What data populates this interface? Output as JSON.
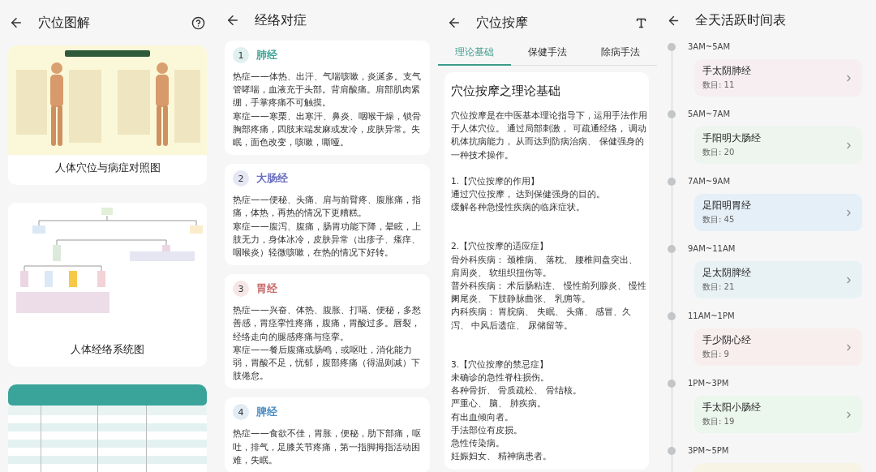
{
  "acupoint_charts": {
    "title": "穴位图解",
    "items": [
      {
        "kind": "picture",
        "caption": "人体穴位与病症对照图"
      },
      {
        "kind": "picture",
        "caption": "人体经络系统图"
      },
      {
        "kind": "picture"
      }
    ]
  },
  "meridian_symptoms": {
    "title": "经络对症",
    "items": [
      {
        "number": "1",
        "name": "肺经",
        "color": "#3fa595",
        "paragraphs": [
          "热症——体热、出汗、气喘咳嗽，炎涎多。支气管哮喘，血液充于头部。背肩酸痛。肩部肌肉紧绷，手掌疼痛不可触摸。",
          "寒症——寒栗、出寒汗、鼻炎、咽喉干燥，锁骨胸部疼痛，四肢末端发麻或发冷，皮肤异常。失眠，面色改变，咳嗽，嘶哑。"
        ]
      },
      {
        "number": "2",
        "name": "大肠经",
        "color": "#6a6fbf",
        "paragraphs": [
          "热症——便秘、头痛、肩与前臂疼、腹胀痛，指痛，体热，再热的情况下更糟糕。",
          "寒症——腹泻、腹痛，肠胃功能下降，晕眩，上肢无力，身体冰冷，皮肤异常（出疹子、瘙痒、咽喉炎）轻微咳嗽，在热的情况下好转。"
        ]
      },
      {
        "number": "3",
        "name": "胃经",
        "color": "#c96a6a",
        "paragraphs": [
          "热症——兴奋、体热、腹胀、打嗝、便秘，多愁善感，胃痉挛性疼痛，腹痛，胃酸过多。唇裂，经络走向的腿感疼痛与痉挛。",
          "寒症——餐后腹痛或肠鸣，或呕吐，消化能力弱，胃酸不足，忧郁，腹部疼痛（得温则减）下肢倦怠。"
        ]
      },
      {
        "number": "4",
        "name": "脾经",
        "color": "#4a8cc4",
        "paragraphs": [
          "热症——食欲不佳，胃胀，便秘，肋下部痛，呕吐，排气，足膝关节疼痛，第一指脚拇指活动困难，失眠。"
        ]
      }
    ]
  },
  "acupressure": {
    "title": "穴位按摩",
    "tabs": [
      {
        "label": "理论基础",
        "selected": true
      },
      {
        "label": "保健手法",
        "selected": false
      },
      {
        "label": "除病手法",
        "selected": false
      }
    ],
    "article": {
      "heading": "穴位按摩之理论基础",
      "intro": [
        "穴位按摩是在中医基本理论指导下，运用手法作用",
        "于人体穴位。 通过局部刺激， 可疏通经络， 调动",
        "机体抗病能力， 从而达到防病治病、 保健强身的",
        "一种技术操作。"
      ],
      "sections": [
        {
          "heading": "1.【穴位按摩的作用】",
          "lines": [
            "通过穴位按摩， 达到保健强身的目的。",
            "缓解各种急慢性疾病的临床症状。"
          ]
        },
        {
          "heading": "2.【穴位按摩的适应症】",
          "lines": [
            "骨外科疾病： 颈椎病、 落枕、 腰椎间盘突出、",
            "肩周炎、 软组织扭伤等。",
            "普外科疾病： 术后肠粘连、 慢性前列腺炎、 慢性",
            "阑尾炎、 下肢静脉曲张、 乳痈等。",
            "内科疾病： 胃脘病、 失眠、 头痛、 感冒、久",
            "泻、 中风后遗症、 尿储留等。"
          ]
        },
        {
          "heading": "3.【穴位按摩的禁忌症】",
          "lines": [
            "未确诊的急性脊柱损伤。",
            "各种骨折、 骨质疏松、 骨结核。",
            "严重心、 脑、 肺疾病。",
            "有出血倾向者。",
            "手法部位有皮损。",
            "急性传染病。",
            "妊娠妇女、 精神病患者。"
          ]
        }
      ]
    }
  },
  "daily_schedule": {
    "title": "全天活跃时间表",
    "items": [
      {
        "time": "3AM~5AM",
        "name": "手太阴肺经",
        "count": "数目: 11",
        "color": "#f6eef1"
      },
      {
        "time": "5AM~7AM",
        "name": "手阳明大肠经",
        "count": "数目: 20",
        "color": "#edf5ee"
      },
      {
        "time": "7AM~9AM",
        "name": "足阳明胃经",
        "count": "数目: 45",
        "color": "#e5eff7"
      },
      {
        "time": "9AM~11AM",
        "name": "足太阴脾经",
        "count": "数目: 21",
        "color": "#e8f2f5"
      },
      {
        "time": "11AM~1PM",
        "name": "手少阴心经",
        "count": "数目: 9",
        "color": "#f8eeee"
      },
      {
        "time": "1PM~3PM",
        "name": "手太阳小肠经",
        "count": "数目: 19",
        "color": "#ebf6ec"
      },
      {
        "time": "3PM~5PM",
        "color": "#f7f4e6"
      }
    ]
  }
}
